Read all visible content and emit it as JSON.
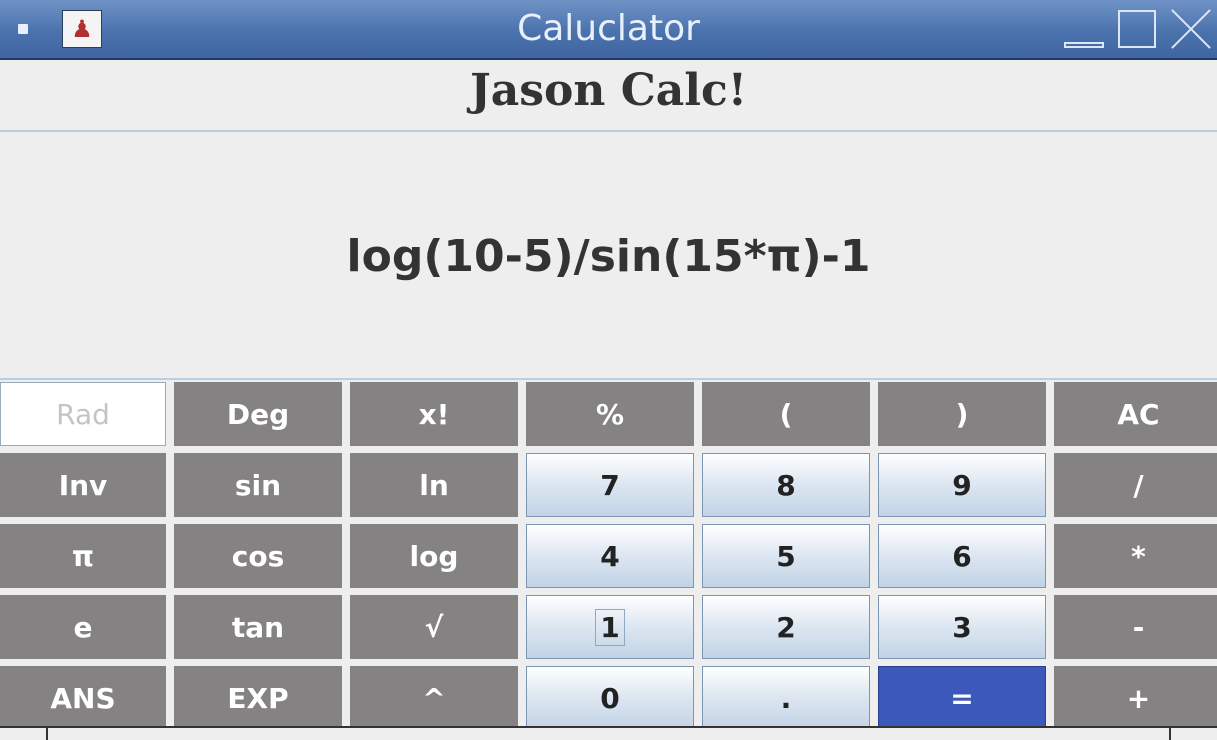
{
  "window": {
    "title": "Caluclator",
    "app_icon": "java-app-icon",
    "controls": [
      "minimize-icon",
      "maximize-icon",
      "close-icon"
    ]
  },
  "header": {
    "title": "Jason Calc!"
  },
  "display": {
    "expression": "log(10-5)/sin(15*π)-1"
  },
  "keys": {
    "row1": [
      "Rad",
      "Deg",
      "x!",
      "%",
      "(",
      ")",
      "AC"
    ],
    "row2": [
      "Inv",
      "sin",
      "ln",
      "7",
      "8",
      "9",
      "/"
    ],
    "row3": [
      "π",
      "cos",
      "log",
      "4",
      "5",
      "6",
      "*"
    ],
    "row4": [
      "e",
      "tan",
      "√",
      "1",
      "2",
      "3",
      "-"
    ],
    "row5": [
      "ANS",
      "EXP",
      "^",
      "0",
      ".",
      "=",
      "+"
    ]
  },
  "state": {
    "angle_mode": "Rad",
    "focused_key": "1"
  },
  "colors": {
    "function_key": "#858283",
    "number_key": "#dfe8f2",
    "equals_key": "#3d58bb",
    "titlebar": "#4a72ad"
  }
}
